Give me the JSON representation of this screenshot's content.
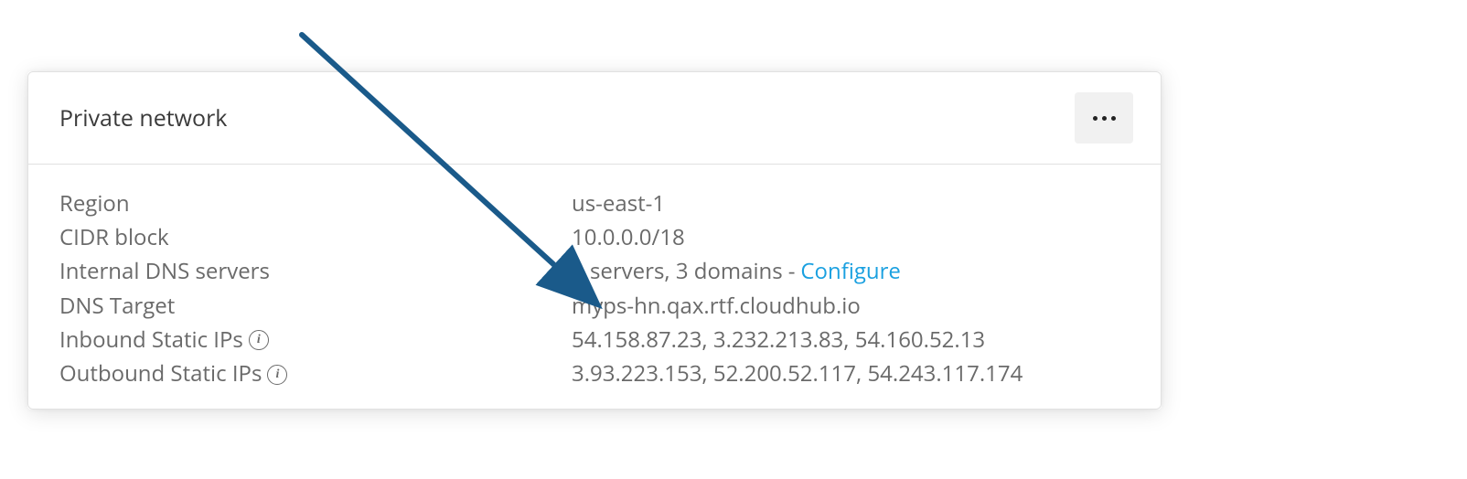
{
  "card": {
    "title": "Private network",
    "rows": {
      "region": {
        "label": "Region",
        "value": "us-east-1"
      },
      "cidr": {
        "label": "CIDR block",
        "value": "10.0.0.0/18"
      },
      "dns_servers": {
        "label": "Internal DNS servers",
        "summary": "3 servers, 3 domains",
        "separator": "-",
        "link": "Configure"
      },
      "dns_target": {
        "label": "DNS Target",
        "value": "myps-hn.qax.rtf.cloudhub.io"
      },
      "inbound": {
        "label": "Inbound Static IPs",
        "value": "54.158.87.23, 3.232.213.83, 54.160.52.13"
      },
      "outbound": {
        "label": "Outbound Static IPs",
        "value": "3.93.223.153, 52.200.52.117, 54.243.117.174"
      }
    }
  },
  "annotation": {
    "arrow_color": "#1a5a8a"
  }
}
